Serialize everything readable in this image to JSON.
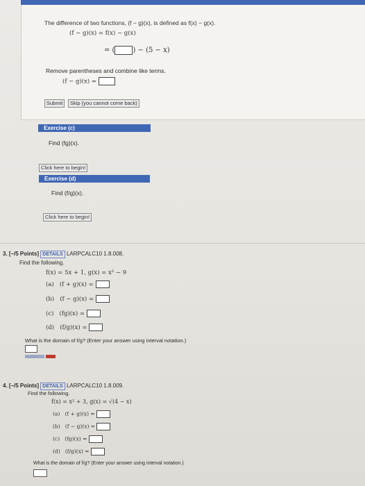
{
  "part_c_block": {
    "intro": "The difference of two functions, (f − g)(x), is defined as f(x) − g(x).",
    "eq1": "(f − g)(x) = f(x) − g(x)",
    "eq2_prefix": "= (",
    "eq2_suffix": ") − (5 − x)",
    "instruction": "Remove parentheses and combine like terms.",
    "eq3_label": "(f − g)(x) =",
    "submit_label": "Submit",
    "skip_label": "Skip (you cannot come back)"
  },
  "exercise_c": {
    "title": "Exercise (c)",
    "prompt": "Find (fg)(x).",
    "begin_label": "Click here to begin!"
  },
  "exercise_d": {
    "title": "Exercise (d)",
    "prompt": "Find (f/g)(x).",
    "begin_label": "Click here to begin!"
  },
  "question3": {
    "number": "3.",
    "points": "[–/5 Points]",
    "details": "DETAILS",
    "code": "LARPCALC10 1.8.008.",
    "instruction": "Find the following.",
    "functions": "f(x) = 5x + 1,   g(x) = x² − 9",
    "parts": [
      {
        "label": "(a)",
        "expr": "(f + g)(x) ="
      },
      {
        "label": "(b)",
        "expr": "(f − g)(x) ="
      },
      {
        "label": "(c)",
        "expr": "(fg)(x) ="
      },
      {
        "label": "(d)",
        "expr": "(f/g)(x) ="
      }
    ],
    "domain_question": "What is the domain of f/g? (Enter your answer using interval notation.)"
  },
  "question4": {
    "number": "4.",
    "points": "[–/5 Points]",
    "details": "DETAILS",
    "code": "LARPCALC10 1.8.009.",
    "instruction": "Find the following.",
    "functions": "f(x) = x² + 3,   g(x) = √(4 − x)",
    "parts": [
      {
        "label": "(a)",
        "expr": "(f + g)(x) ="
      },
      {
        "label": "(b)",
        "expr": "(f − g)(x) ="
      },
      {
        "label": "(c)",
        "expr": "(fg)(x) ="
      },
      {
        "label": "(d)",
        "expr": "(f/g)(x) ="
      }
    ],
    "domain_question": "What is the domain of f/g? (Enter your answer using interval notation.)"
  },
  "colors": {
    "accent": "#3f67b4",
    "card": "#f4f3f0",
    "page": "#e6e4df"
  }
}
